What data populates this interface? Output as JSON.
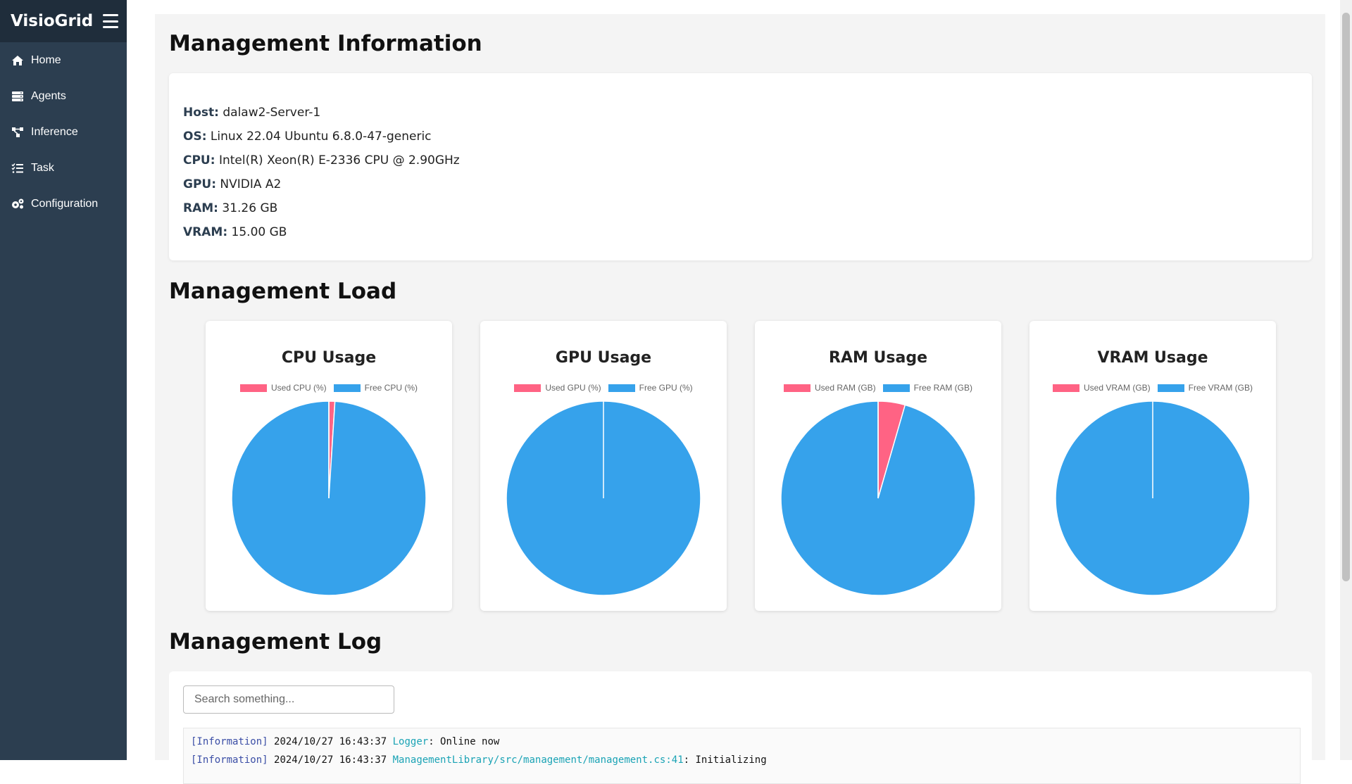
{
  "sidebar": {
    "brand": "VisioGrid",
    "items": [
      {
        "label": "Home",
        "icon": "home-icon"
      },
      {
        "label": "Agents",
        "icon": "server-icon"
      },
      {
        "label": "Inference",
        "icon": "network-icon"
      },
      {
        "label": "Task",
        "icon": "task-list-icon"
      },
      {
        "label": "Configuration",
        "icon": "gears-icon"
      }
    ]
  },
  "info": {
    "title": "Management Information",
    "rows": [
      {
        "key": "Host:",
        "value": "dalaw2-Server-1"
      },
      {
        "key": "OS:",
        "value": "Linux 22.04 Ubuntu 6.8.0-47-generic"
      },
      {
        "key": "CPU:",
        "value": "Intel(R) Xeon(R) E-2336 CPU @ 2.90GHz"
      },
      {
        "key": "GPU:",
        "value": "NVIDIA A2"
      },
      {
        "key": "RAM:",
        "value": "31.26 GB"
      },
      {
        "key": "VRAM:",
        "value": "15.00 GB"
      }
    ]
  },
  "load": {
    "title": "Management Load"
  },
  "colors": {
    "used": "#ff6384",
    "free": "#36a2eb"
  },
  "chart_data": [
    {
      "type": "pie",
      "title": "CPU Usage",
      "categories": [
        "Used CPU (%)",
        "Free CPU (%)"
      ],
      "values": [
        1,
        99
      ]
    },
    {
      "type": "pie",
      "title": "GPU Usage",
      "categories": [
        "Used GPU (%)",
        "Free GPU (%)"
      ],
      "values": [
        0,
        100
      ]
    },
    {
      "type": "pie",
      "title": "RAM Usage",
      "categories": [
        "Used RAM (GB)",
        "Free RAM (GB)"
      ],
      "values": [
        1.4,
        29.86
      ]
    },
    {
      "type": "pie",
      "title": "VRAM Usage",
      "categories": [
        "Used VRAM (GB)",
        "Free VRAM (GB)"
      ],
      "values": [
        0,
        15.0
      ]
    }
  ],
  "log": {
    "title": "Management Log",
    "search_placeholder": "Search something...",
    "lines": [
      {
        "level": "[Information]",
        "timestamp": "2024/10/27 16:43:37",
        "source": "Logger",
        "message": ": Online now"
      },
      {
        "level": "[Information]",
        "timestamp": "2024/10/27 16:43:37",
        "source": "ManagementLibrary/src/management/management.cs:41",
        "message": ": Initializing"
      }
    ]
  }
}
